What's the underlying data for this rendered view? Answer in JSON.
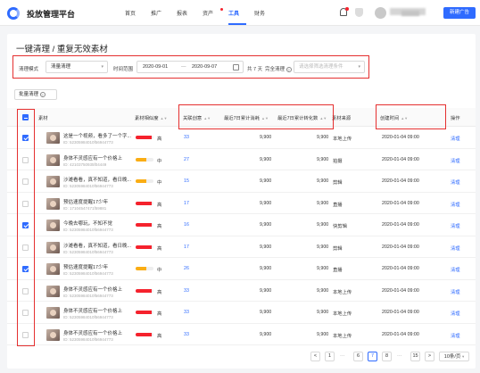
{
  "header": {
    "app_title": "投放管理平台",
    "nav": [
      {
        "label": "首页",
        "active": false
      },
      {
        "label": "推广",
        "active": false
      },
      {
        "label": "报表",
        "active": false
      },
      {
        "label": "资产",
        "active": false,
        "dot": true
      },
      {
        "label": "工具",
        "active": true
      },
      {
        "label": "财务",
        "active": false
      }
    ],
    "primary_button": "新建广告"
  },
  "page": {
    "title": "一键清理 / 重复无效素材"
  },
  "filters": {
    "mode_label": "清理模式",
    "mode_value": "清量清理",
    "time_label": "时间范围",
    "date_start": "2020-09-01",
    "date_sep": "—",
    "date_end": "2020-09-07",
    "days_text": "共 7 天",
    "cleanup_label": "完全清理",
    "cleanup_placeholder": "请选择筛选清理条件"
  },
  "batch_button": "批量清理",
  "table": {
    "columns": [
      "",
      "素材",
      "素材相似度",
      "关联创意",
      "最近7日累计消耗",
      "最近7日累计转化数",
      "素材来源",
      "创建时间",
      "操作"
    ],
    "rows": [
      {
        "checked": true,
        "title": "这是一个视频，看多了一个字...",
        "id": "ID: 52305984010f56944773",
        "level": "高",
        "color": "#f5222d",
        "fill": 0.9,
        "count": "33",
        "cost": "9,900",
        "conv": "9,900",
        "source": "本地上传",
        "date": "2020-01-04  09:00",
        "action": "清理"
      },
      {
        "checked": false,
        "title": "身体不灵感应有一个价格上",
        "id": "ID: 42103750935f04449",
        "level": "中",
        "color": "#faad14",
        "fill": 0.6,
        "count": "27",
        "cost": "9,900",
        "conv": "9,900",
        "source": "拍摄",
        "date": "2020-01-04  09:00",
        "action": "清理"
      },
      {
        "checked": false,
        "title": "沙滩看看，真不知道，看日晚...",
        "id": "ID: 52305984010f56944773",
        "level": "中",
        "color": "#faad14",
        "fill": 0.6,
        "count": "15",
        "cost": "9,900",
        "conv": "9,900",
        "source": "剪辑",
        "date": "2020-01-04  09:00",
        "action": "清理"
      },
      {
        "checked": false,
        "title": "预估速度提醒17少年",
        "id": "ID: 17104547471f59881",
        "level": "高",
        "color": "#f5222d",
        "fill": 0.9,
        "count": "17",
        "cost": "9,900",
        "conv": "9,900",
        "source": "直播",
        "date": "2020-01-04  09:00",
        "action": "清理"
      },
      {
        "checked": true,
        "title": "今晚去哪玩，不知不觉",
        "id": "ID: 52305984010f56944773",
        "level": "高",
        "color": "#f5222d",
        "fill": 0.9,
        "count": "16",
        "cost": "9,900",
        "conv": "9,900",
        "source": "快剪辑",
        "date": "2020-01-04  09:00",
        "action": "清理"
      },
      {
        "checked": false,
        "title": "沙滩看看，真不知道，看日晚...",
        "id": "ID: 52305984010f56944773",
        "level": "高",
        "color": "#f5222d",
        "fill": 0.9,
        "count": "17",
        "cost": "9,900",
        "conv": "9,900",
        "source": "剪辑",
        "date": "2020-01-04  09:00",
        "action": "清理"
      },
      {
        "checked": true,
        "title": "预估速度提醒17少年",
        "id": "ID: 52305984010f56944773",
        "level": "中",
        "color": "#faad14",
        "fill": 0.6,
        "count": "26",
        "cost": "9,900",
        "conv": "9,900",
        "source": "直播",
        "date": "2020-01-04  09:00",
        "action": "清理"
      },
      {
        "checked": false,
        "title": "身体不灵感应有一个价格上",
        "id": "ID: 52305984010f56944773",
        "level": "高",
        "color": "#f5222d",
        "fill": 0.9,
        "count": "33",
        "cost": "9,900",
        "conv": "9,900",
        "source": "本地上传",
        "date": "2020-01-04  09:00",
        "action": "清理"
      },
      {
        "checked": false,
        "title": "身体不灵感应有一个价格上",
        "id": "ID: 52305984010f56944773",
        "level": "高",
        "color": "#f5222d",
        "fill": 0.9,
        "count": "33",
        "cost": "9,900",
        "conv": "9,900",
        "source": "本地上传",
        "date": "2020-01-04  09:00",
        "action": "清理"
      },
      {
        "checked": false,
        "title": "身体不灵感应有一个价格上",
        "id": "ID: 52305984010f56944773",
        "level": "高",
        "color": "#f5222d",
        "fill": 0.9,
        "count": "33",
        "cost": "9,900",
        "conv": "9,900",
        "source": "本地上传",
        "date": "2020-01-04  09:00",
        "action": "清理"
      }
    ]
  },
  "pagination": {
    "prev": "<",
    "pages": [
      "1",
      "6",
      "7",
      "8",
      "15"
    ],
    "current": "7",
    "next": ">",
    "size_select": "10条/页"
  }
}
